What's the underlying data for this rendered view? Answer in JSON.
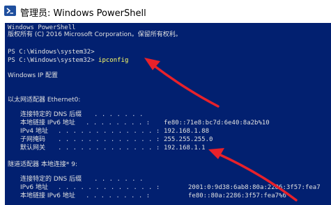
{
  "window": {
    "title": "管理员: Windows PowerShell",
    "icon": "powershell-icon"
  },
  "console": {
    "header_line1": "Windows PowerShell",
    "header_line2": "版权所有 (C) 2016 Microsoft Corporation。保留所有权利。",
    "prompt1": "PS C:\\Windows\\system32>",
    "prompt2": "PS C:\\Windows\\system32>",
    "command": "ipconfig",
    "ip_config_title": "Windows IP 配置",
    "ethernet": {
      "header": "以太网适配器 Ethernet0:",
      "rows": [
        {
          "label": "连接特定的 DNS 后缀",
          "dots": ". . . . . . .",
          "value": ""
        },
        {
          "label": "本地链接 IPv6 地址",
          "dots": ". . . . . . . . :",
          "value": "fe80::71e8:bc7d:6e40:8a2b%10"
        },
        {
          "label": "IPv4 地址",
          "dots": ". . . . . . . . . . . . . :",
          "value": "192.168.1.88"
        },
        {
          "label": "子网掩码",
          "dots": ". . . . . . . . . . . . . :",
          "value": "255.255.255.0"
        },
        {
          "label": "默认网关",
          "dots": ". . . . . . . . . . . . . :",
          "value": "192.168.1.1"
        }
      ]
    },
    "tunnel": {
      "header": "隧道适配器 本地连接* 9:",
      "rows": [
        {
          "label": "连接特定的 DNS 后缀",
          "dots": ". . . . . . .",
          "value": ""
        },
        {
          "label": "IPv6 地址",
          "dots": ". . . . . . . . . . . . . :",
          "value": "2001:0:9d38:6ab8:80a:2286:3f57:fea7"
        },
        {
          "label": "本地链接 IPv6 地址",
          "dots": ". . . . . . . . :",
          "value": "fe80::80a:2286:3f57:fea7%6"
        }
      ]
    }
  },
  "colors": {
    "console_background": "#022070",
    "console_text": "#e0e0e0",
    "command_text": "#ffff66",
    "annotation_arrow": "#e8212a"
  }
}
